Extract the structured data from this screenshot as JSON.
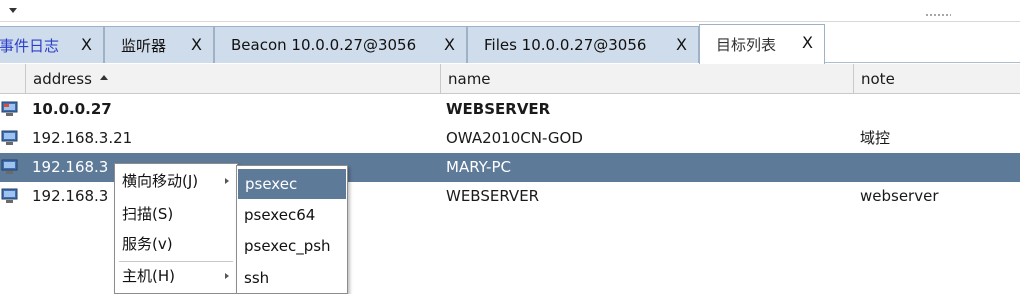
{
  "tabs": [
    {
      "label": "事件日志",
      "close": "X"
    },
    {
      "label": "监听器",
      "close": "X"
    },
    {
      "label": "Beacon 10.0.0.27@3056",
      "close": "X"
    },
    {
      "label": "Files 10.0.0.27@3056",
      "close": "X"
    },
    {
      "label": "目标列表",
      "close": "X"
    }
  ],
  "table": {
    "columns": [
      "address",
      "name",
      "note"
    ],
    "sorted_column": "address",
    "rows": [
      {
        "address": "10.0.0.27",
        "name": "WEBSERVER",
        "note": ""
      },
      {
        "address": "192.168.3.21",
        "name": "OWA2010CN-GOD",
        "note": "域控"
      },
      {
        "address": "192.168.3",
        "name": "MARY-PC",
        "note": ""
      },
      {
        "address": "192.168.3",
        "name": "WEBSERVER",
        "note": "webserver"
      }
    ]
  },
  "context_menu": {
    "items": [
      "横向移动(J)",
      "扫描(S)",
      "服务(v)",
      "主机(H)"
    ]
  },
  "submenu": {
    "items": [
      "psexec",
      "psexec64",
      "psexec_psh",
      "ssh"
    ]
  },
  "colors": {
    "selection": "#5e7a99",
    "tab_inactive": "#cfdceb",
    "tab_first_label": "#2b40c9"
  }
}
